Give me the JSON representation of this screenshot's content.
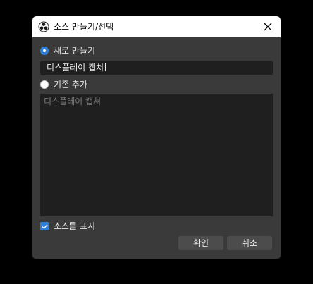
{
  "window": {
    "title": "소스 만들기/선택"
  },
  "options": {
    "create_new_label": "새로 만들기",
    "add_existing_label": "기존 추가"
  },
  "name_input": {
    "value": "디스플레이 캡쳐"
  },
  "existing_sources": [
    "디스플레이 캡쳐"
  ],
  "visibility": {
    "label": "소스를 표시",
    "checked": true
  },
  "buttons": {
    "ok_label": "확인",
    "cancel_label": "취소"
  },
  "colors": {
    "accent": "#2f7fd6",
    "window_bg": "#3a3a3a",
    "input_bg": "#1f1f1f",
    "button_bg": "#4c4c4c"
  },
  "icons": {
    "app": "obs-logo-icon",
    "close": "close-icon",
    "check": "checkmark-icon"
  }
}
